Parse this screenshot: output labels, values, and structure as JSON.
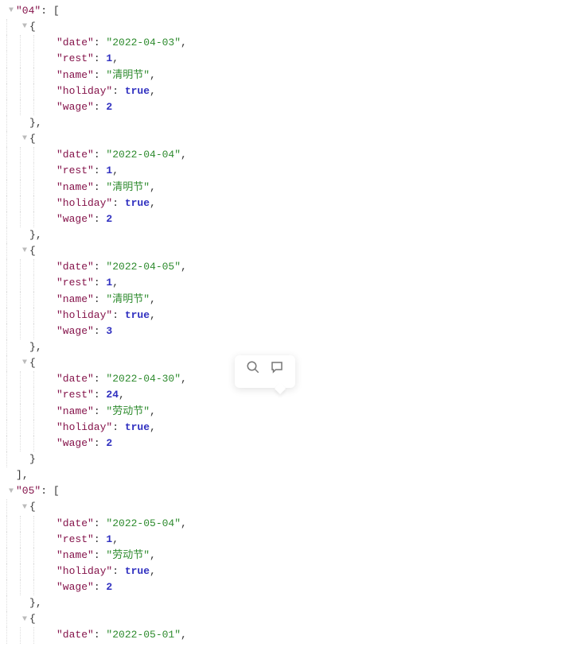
{
  "months": [
    {
      "key": "04",
      "closed_with_comma": true,
      "items": [
        {
          "date": "2022-04-03",
          "rest": 1,
          "name": "清明节",
          "holiday": true,
          "wage": 2
        },
        {
          "date": "2022-04-04",
          "rest": 1,
          "name": "清明节",
          "holiday": true,
          "wage": 2
        },
        {
          "date": "2022-04-05",
          "rest": 1,
          "name": "清明节",
          "holiday": true,
          "wage": 3
        },
        {
          "date": "2022-04-30",
          "rest": 24,
          "name": "劳动节",
          "holiday": true,
          "wage": 2
        }
      ]
    },
    {
      "key": "05",
      "closed_with_comma": false,
      "items": [
        {
          "date": "2022-05-04",
          "rest": 1,
          "name": "劳动节",
          "holiday": true,
          "wage": 2
        },
        {
          "date": "2022-05-01",
          "_partial": true
        }
      ]
    }
  ],
  "field_labels": {
    "date": "date",
    "rest": "rest",
    "name": "name",
    "holiday": "holiday",
    "wage": "wage"
  },
  "bubble_icons": [
    "magnify-icon",
    "chat-icon"
  ]
}
